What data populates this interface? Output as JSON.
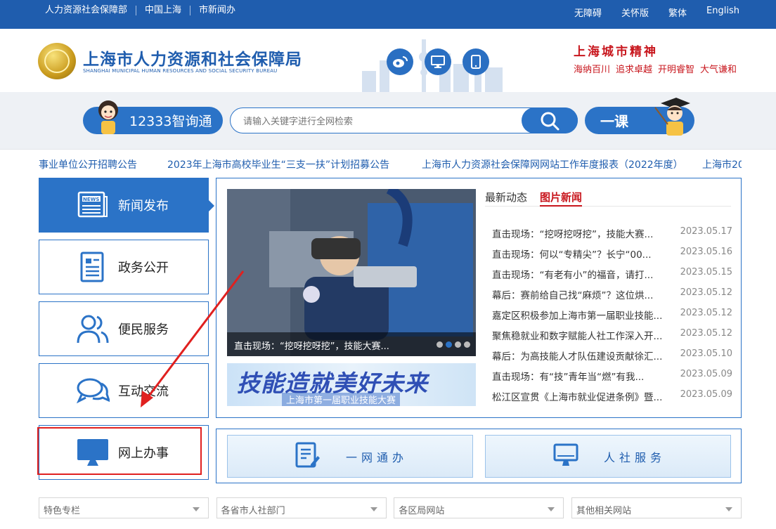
{
  "topbar": {
    "links": [
      "人力资源社会保障部",
      "中国上海",
      "市新闻办"
    ],
    "right_links": [
      "无障碍",
      "关怀版",
      "繁体",
      "English"
    ]
  },
  "header": {
    "title": "上海市人力资源和社会保障局",
    "subtitle": "SHANGHAI MUNICIPAL HUMAN RESOURCES AND SOCIAL SECURITY BUREAU",
    "spirit_title": "上海城市精神",
    "spirit_words": [
      "海纳百川",
      "追求卓越",
      "开明睿智",
      "大气谦和"
    ],
    "icons": [
      "weibo-icon",
      "desktop-icon",
      "mobile-icon"
    ]
  },
  "search": {
    "zxt_label": "12333智询通",
    "placeholder": "请输入关键字进行全网检索",
    "yike_label": "一课"
  },
  "ticker": [
    "事业单位公开招聘公告",
    "2023年上海市高校毕业生“三支一扶”计划招募公告",
    "上海市人力资源社会保障网网站工作年度报表（2022年度）",
    "上海市20"
  ],
  "nav": [
    {
      "label": "新闻发布",
      "icon": "news-icon",
      "active": true
    },
    {
      "label": "政务公开",
      "icon": "document-icon",
      "active": false
    },
    {
      "label": "便民服务",
      "icon": "people-icon",
      "active": false
    },
    {
      "label": "互动交流",
      "icon": "chat-icon",
      "active": false
    },
    {
      "label": "网上办事",
      "icon": "monitor-icon",
      "active": false
    }
  ],
  "news": {
    "photo_caption": "直击现场：“挖呀挖呀挖”，技能大赛...",
    "banner_big": "技能造就美好未来",
    "banner_small": "上海市第一届职业技能大赛",
    "tabs": [
      "最新动态",
      "图片新闻"
    ],
    "active_tab": 1,
    "items": [
      {
        "title": "直击现场：“挖呀挖呀挖”，技能大赛...",
        "date": "2023.05.17"
      },
      {
        "title": "直击现场：何以“专精尖”？长宁“00...",
        "date": "2023.05.16"
      },
      {
        "title": "直击现场：“有老有小”的福音，请打...",
        "date": "2023.05.15"
      },
      {
        "title": "幕后：赛前给自己找“麻烦”？这位烘...",
        "date": "2023.05.12"
      },
      {
        "title": "嘉定区积极参加上海市第一届职业技能...",
        "date": "2023.05.12"
      },
      {
        "title": "聚焦稳就业和数字赋能人社工作深入开...",
        "date": "2023.05.12"
      },
      {
        "title": "幕后：为高技能人才队伍建设贡献徐汇...",
        "date": "2023.05.10"
      },
      {
        "title": "直击现场：有“技”青年当“燃”有我...",
        "date": "2023.05.09"
      },
      {
        "title": "松江区宣贯《上海市就业促进条例》暨...",
        "date": "2023.05.09"
      }
    ]
  },
  "services": [
    {
      "label": "一网通办",
      "icon": "form-edit-icon"
    },
    {
      "label": "人社服务",
      "icon": "monitor-icon"
    }
  ],
  "dropdowns": [
    "特色专栏",
    "各省市人社部门",
    "各区局网站",
    "其他相关网站"
  ],
  "colors": {
    "primary": "#2b73c7",
    "topbar": "#1f5dae",
    "accent_red": "#c8161d"
  }
}
